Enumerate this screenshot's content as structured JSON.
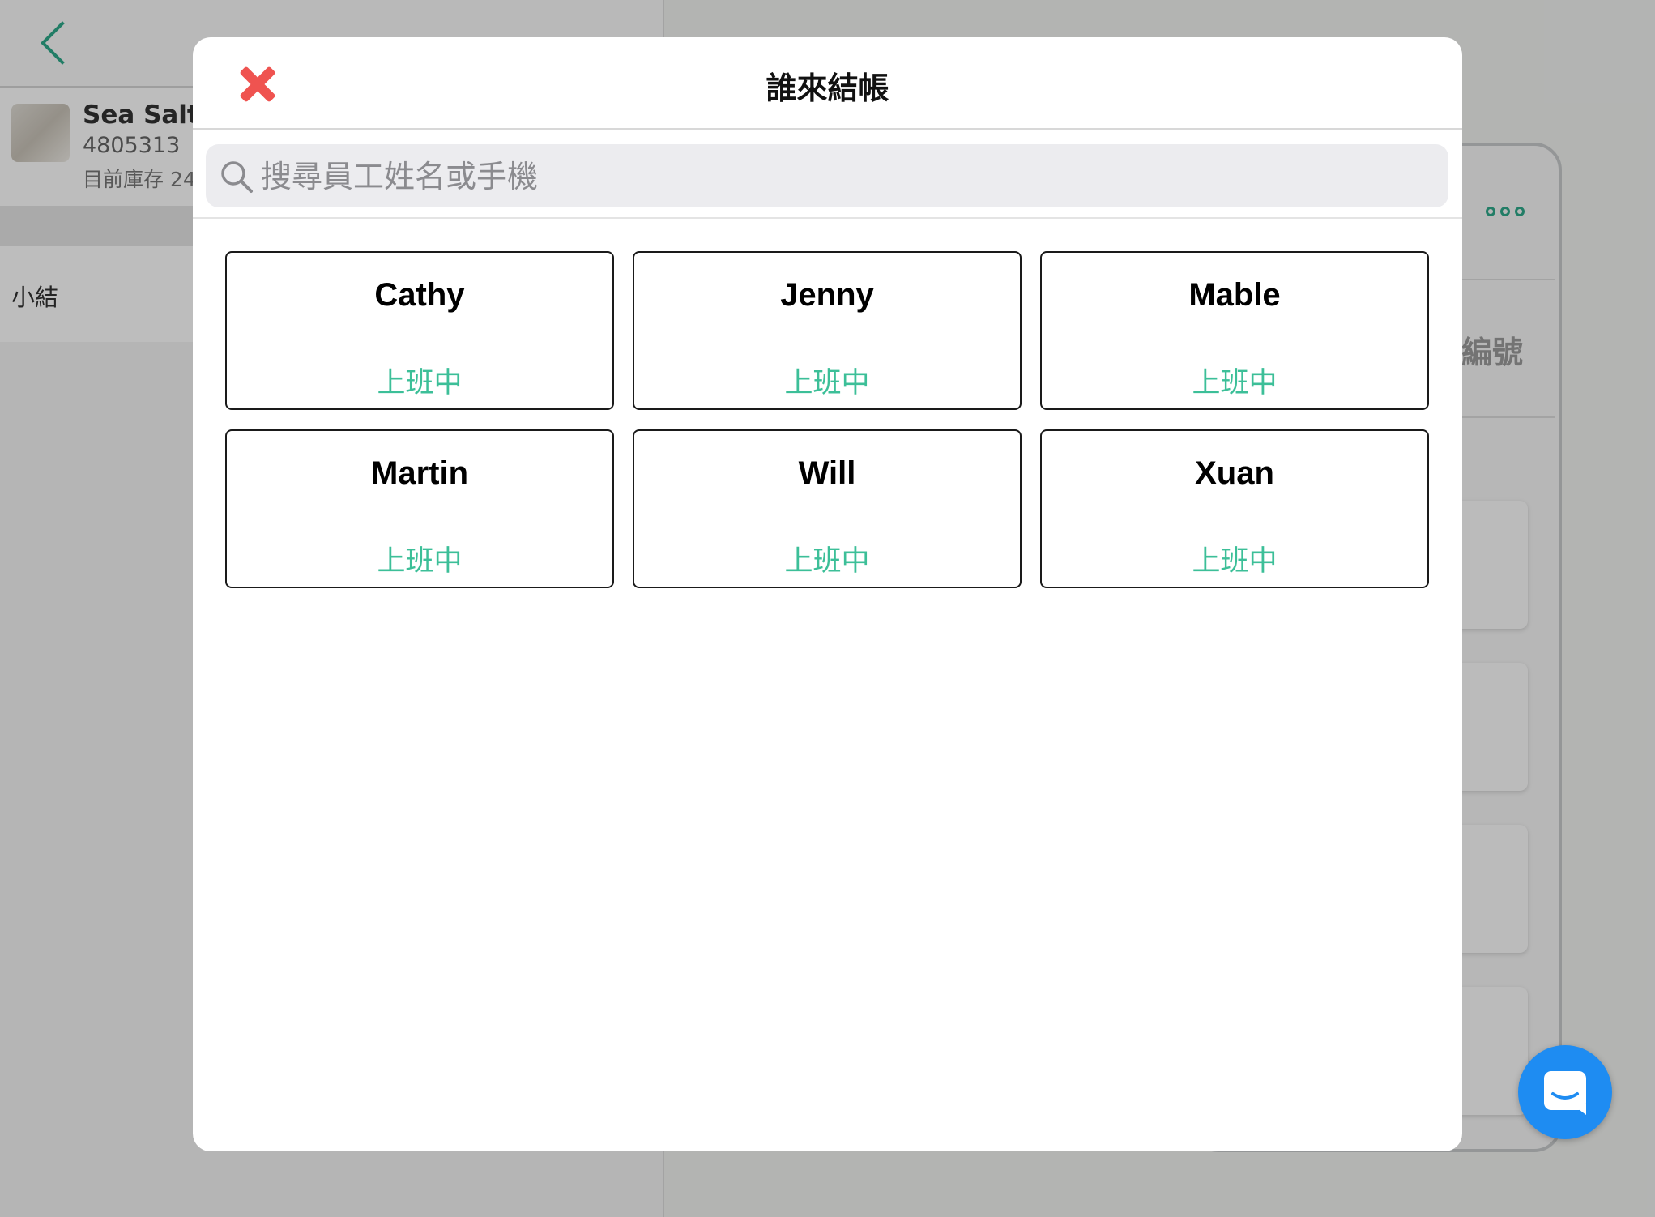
{
  "background": {
    "product": {
      "name": "Sea Salt S",
      "code": "4805313",
      "stock": "目前庫存 24"
    },
    "subtotal_label": "小結",
    "right_panel_label": "編號"
  },
  "modal": {
    "title": "誰來結帳",
    "search": {
      "placeholder": "搜尋員工姓名或手機",
      "value": ""
    },
    "staff": [
      {
        "name": "Cathy",
        "status": "上班中"
      },
      {
        "name": "Jenny",
        "status": "上班中"
      },
      {
        "name": "Mable",
        "status": "上班中"
      },
      {
        "name": "Martin",
        "status": "上班中"
      },
      {
        "name": "Will",
        "status": "上班中"
      },
      {
        "name": "Xuan",
        "status": "上班中"
      }
    ]
  },
  "colors": {
    "accent_green": "#3cbf98",
    "close_red": "#ef5350",
    "chat_blue": "#1e8cf2"
  },
  "icons": [
    "back-chevron-icon",
    "close-icon",
    "search-icon",
    "more-dots-icon",
    "chat-icon"
  ]
}
